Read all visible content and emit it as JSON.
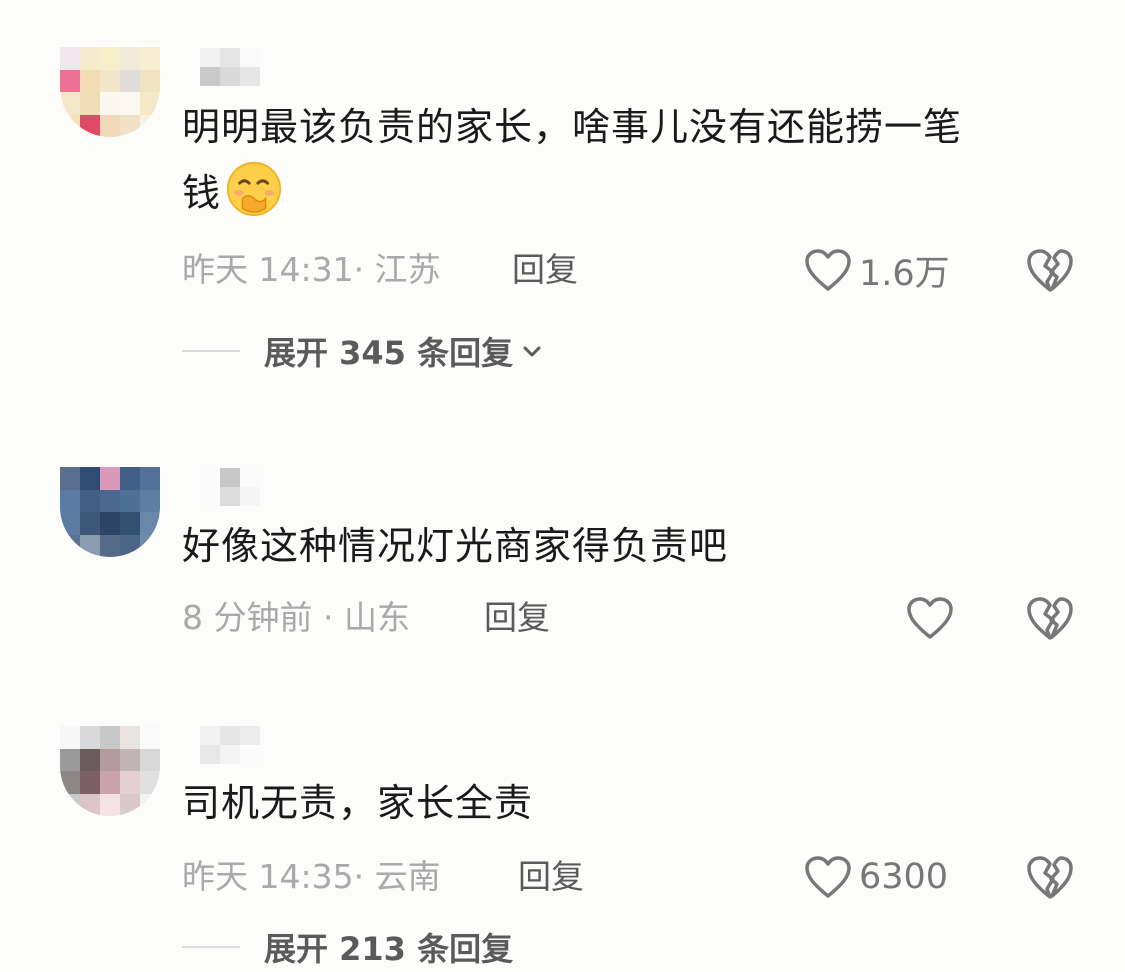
{
  "comments": [
    {
      "text": "明明最该负责的家长，啥事儿没有还能捞一笔钱",
      "text_line1": "明明最该负责的家长，啥事儿没有还能捞一笔",
      "text_line2": "钱",
      "emoji": "shushing-face-emoji",
      "meta": "昨天 14:31· 江苏",
      "reply_label": "回复",
      "likes": "1.6万",
      "expand_label": "展开 345 条回复"
    },
    {
      "text": "好像这种情况灯光商家得负责吧",
      "meta": "8 分钟前 · 山东",
      "reply_label": "回复",
      "likes": ""
    },
    {
      "text": "司机无责，家长全责",
      "meta": "昨天 14:35· 云南",
      "reply_label": "回复",
      "likes": "6300",
      "expand_label": "展开 213 条回复"
    }
  ],
  "icons": {
    "like": "heart-outline-icon",
    "dislike": "broken-heart-icon",
    "expand": "chevron-down-icon"
  },
  "colors": {
    "background": "#fcfcfa",
    "text": "#1a1a1a",
    "meta": "#a9a9a9",
    "reply": "#5a5a5a",
    "icon": "#777777"
  }
}
